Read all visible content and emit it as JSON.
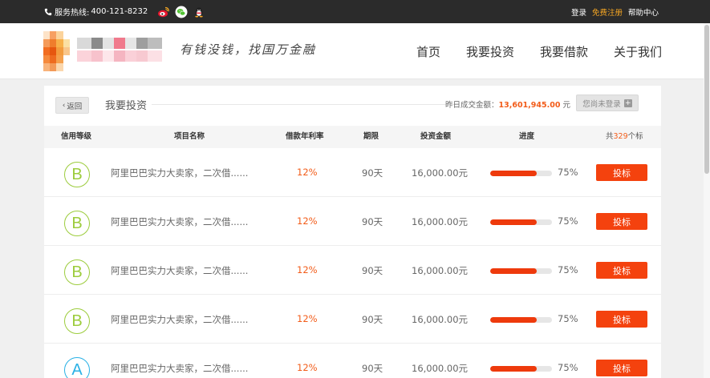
{
  "topbar": {
    "hotline_label": "服务热线:",
    "hotline_number": "400-121-8232",
    "login": "登录",
    "register": "免费注册",
    "help": "帮助中心"
  },
  "header": {
    "slogan": "有钱没钱，找国万金融",
    "nav": [
      "首页",
      "我要投资",
      "我要借款",
      "关于我们"
    ]
  },
  "panel": {
    "back_label": "返回",
    "title": "我要投资",
    "volume_label": "昨日成交金额：",
    "volume_amount": "13,601,945.00",
    "volume_unit": "元",
    "login_status": "您尚未登录",
    "columns": {
      "credit": "信用等级",
      "name": "项目名称",
      "rate": "借款年利率",
      "term": "期限",
      "amount": "投资金额",
      "progress": "进度"
    },
    "count_prefix": "共",
    "count_num": "329",
    "count_suffix": "个标",
    "rows": [
      {
        "level": "B",
        "name": "阿里巴巴实力大卖家，二次借......",
        "rate": "12%",
        "term": "90天",
        "amount": "16,000.00元",
        "progress": 75,
        "progress_text": "75%",
        "button": "投标"
      },
      {
        "level": "B",
        "name": "阿里巴巴实力大卖家，二次借......",
        "rate": "12%",
        "term": "90天",
        "amount": "16,000.00元",
        "progress": 75,
        "progress_text": "75%",
        "button": "投标"
      },
      {
        "level": "B",
        "name": "阿里巴巴实力大卖家，二次借......",
        "rate": "12%",
        "term": "90天",
        "amount": "16,000.00元",
        "progress": 75,
        "progress_text": "75%",
        "button": "投标"
      },
      {
        "level": "B",
        "name": "阿里巴巴实力大卖家，二次借......",
        "rate": "12%",
        "term": "90天",
        "amount": "16,000.00元",
        "progress": 75,
        "progress_text": "75%",
        "button": "投标"
      },
      {
        "level": "A",
        "name": "阿里巴巴实力大卖家，二次借......",
        "rate": "12%",
        "term": "90天",
        "amount": "16,000.00元",
        "progress": 75,
        "progress_text": "75%",
        "button": "投标"
      }
    ]
  },
  "colors": {
    "accent": "#f4420e",
    "level_b": "#9ccc3c",
    "level_a": "#2ab1e5",
    "topbar_bg": "#2b2b2b"
  },
  "icons": {
    "phone": "phone-icon",
    "weibo": "weibo-icon",
    "wechat": "wechat-icon",
    "qq": "qq-icon"
  }
}
